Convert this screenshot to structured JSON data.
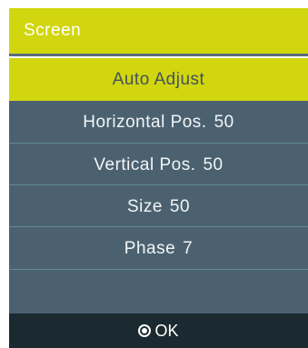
{
  "window": {
    "title": "Screen"
  },
  "menu": {
    "items": [
      {
        "label": "Auto Adjust",
        "value": "",
        "selected": true
      },
      {
        "label": "Horizontal Pos.",
        "value": "50",
        "selected": false
      },
      {
        "label": "Vertical Pos.",
        "value": "50",
        "selected": false
      },
      {
        "label": "Size",
        "value": "50",
        "selected": false
      },
      {
        "label": "Phase",
        "value": "7",
        "selected": false
      }
    ]
  },
  "footer": {
    "ok_label": "OK",
    "ok_icon": "ok-circle-icon"
  },
  "colors": {
    "accent": "#d1d60e",
    "panel": "#4b6170",
    "footer": "#1b2a30",
    "row_line": "#5e8c92"
  }
}
